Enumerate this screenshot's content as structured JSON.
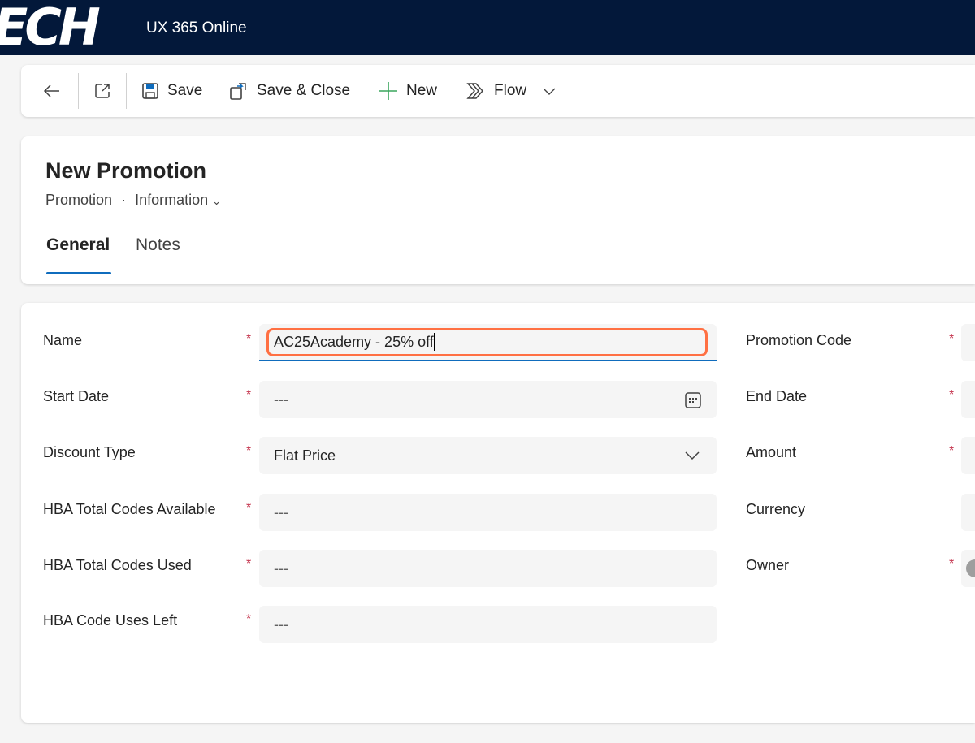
{
  "header": {
    "logo_text": "ECH",
    "app_title": "UX 365 Online"
  },
  "commands": {
    "save": "Save",
    "save_close": "Save & Close",
    "new": "New",
    "flow": "Flow"
  },
  "record": {
    "title": "New Promotion",
    "entity": "Promotion",
    "separator": "·",
    "form": "Information"
  },
  "tabs": [
    {
      "label": "General",
      "active": true
    },
    {
      "label": "Notes",
      "active": false
    }
  ],
  "fields_left": [
    {
      "label": "Name",
      "required": true,
      "value": "AC25Academy - 25% off"
    },
    {
      "label": "Start Date",
      "required": true,
      "value": "---"
    },
    {
      "label": "Discount Type",
      "required": true,
      "value": "Flat Price"
    },
    {
      "label": "HBA Total Codes Available",
      "required": true,
      "value": "---"
    },
    {
      "label": "HBA Total Codes Used",
      "required": true,
      "value": "---"
    },
    {
      "label": "HBA Code Uses Left",
      "required": true,
      "value": "---"
    }
  ],
  "fields_right": [
    {
      "label": "Promotion Code",
      "required": true
    },
    {
      "label": "End Date",
      "required": true
    },
    {
      "label": "Amount",
      "required": true
    },
    {
      "label": "Currency",
      "required": false
    },
    {
      "label": "Owner",
      "required": true
    }
  ],
  "required_mark": "*",
  "colors": {
    "topbar": "#03183a",
    "highlight": "#ff7043",
    "accent": "#0f6cbd",
    "required": "#c4314b"
  }
}
